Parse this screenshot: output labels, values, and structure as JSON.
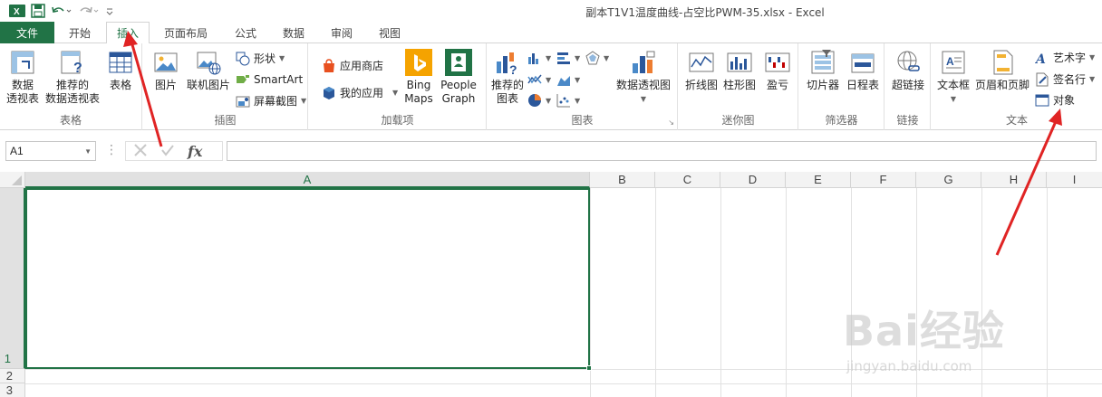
{
  "window": {
    "title": "副本T1V1温度曲线-占空比PWM-35.xlsx - Excel"
  },
  "tabs": {
    "file": "文件",
    "items": [
      "开始",
      "插入",
      "页面布局",
      "公式",
      "数据",
      "审阅",
      "视图"
    ],
    "active": "插入"
  },
  "ribbon": {
    "tables": {
      "label": "表格",
      "pivot": "数据\n透视表",
      "recommended_pivot": "推荐的\n数据透视表",
      "table": "表格"
    },
    "illustrations": {
      "label": "插图",
      "pictures": "图片",
      "online_pictures": "联机图片",
      "shapes": "形状",
      "smartart": "SmartArt",
      "screenshot": "屏幕截图"
    },
    "addins": {
      "label": "加载项",
      "store": "应用商店",
      "my_apps": "我的应用",
      "bing_maps": "Bing\nMaps",
      "people_graph": "People\nGraph"
    },
    "charts": {
      "label": "图表",
      "recommended_charts": "推荐的\n图表",
      "pivot_chart": "数据透视图"
    },
    "sparklines": {
      "label": "迷你图",
      "line": "折线图",
      "column": "柱形图",
      "winloss": "盈亏"
    },
    "filters": {
      "label": "筛选器",
      "slicer": "切片器",
      "timeline": "日程表"
    },
    "links": {
      "label": "链接",
      "hyperlink": "超链接"
    },
    "text": {
      "label": "文本",
      "textbox": "文本框",
      "header_footer": "页眉和页脚",
      "wordart": "艺术字",
      "signature": "签名行",
      "object": "对象"
    }
  },
  "formula_bar": {
    "name_box": "A1",
    "fx": "fx",
    "value": ""
  },
  "grid": {
    "columns": [
      "A",
      "B",
      "C",
      "D",
      "E",
      "F",
      "G",
      "H",
      "I"
    ],
    "rows": [
      "1",
      "2",
      "3"
    ],
    "selected_cell": "A1"
  },
  "watermark": {
    "main": "Bai经验",
    "sub": "jingyan.baidu.com"
  },
  "colors": {
    "accent": "#217346",
    "annotation": "#e02424"
  }
}
